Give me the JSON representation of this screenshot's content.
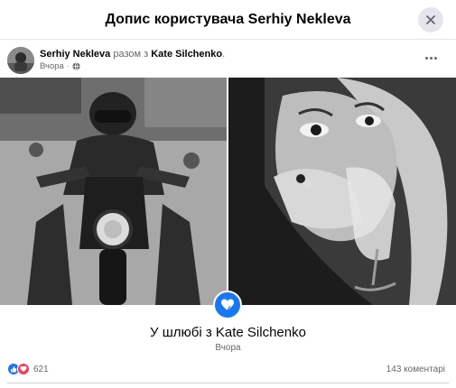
{
  "modal": {
    "title": "Допис користувача Serhiy Nekleva",
    "close_icon": "close-icon"
  },
  "post": {
    "author": "Serhiy Nekleva",
    "with_text": "разом з",
    "tagged": "Kate Silchenko",
    "tagged_suffix": ".",
    "time": "Вчора",
    "separator": "·",
    "privacy_icon": "globe-icon",
    "more_icon": "more-horizontal-icon"
  },
  "photos": [
    {
      "name": "photo-motorcycle",
      "alt": "person on motorcycle"
    },
    {
      "name": "photo-woman-glass",
      "alt": "woman with glass"
    }
  ],
  "life_event": {
    "icon": "heart-icon",
    "title": "У шлюбі з Kate Silchenko",
    "time": "Вчора"
  },
  "footer": {
    "reactions_count": "621",
    "reaction_icons": [
      "like-icon",
      "love-icon"
    ],
    "comments": "143 коментарі"
  },
  "colors": {
    "accent": "#1877f2",
    "love": "#f33e58",
    "secondary_text": "#65676b",
    "divider": "#e4e6eb"
  }
}
